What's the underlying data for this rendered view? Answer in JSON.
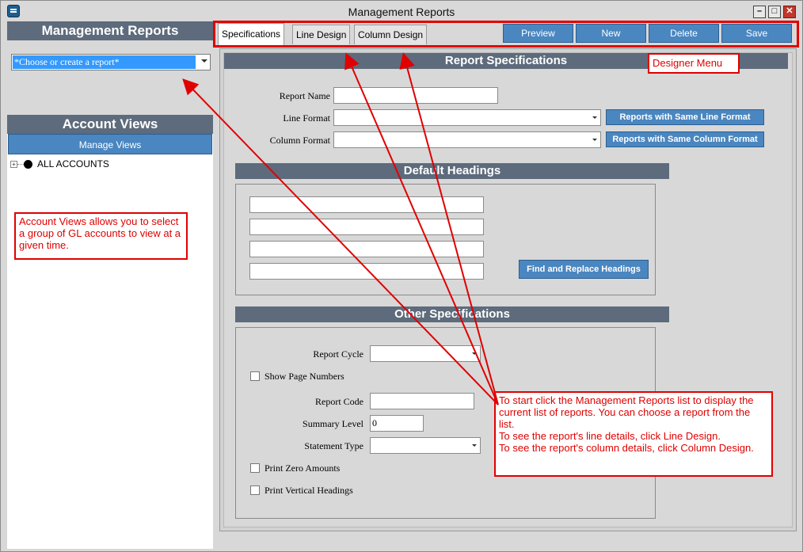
{
  "window": {
    "title": "Management Reports"
  },
  "left": {
    "management_reports_header": "Management Reports",
    "report_select_value": "*Choose or create a report*",
    "account_views_header": "Account Views",
    "manage_views_label": "Manage Views",
    "tree_root_label": "ALL ACCOUNTS"
  },
  "tabs": [
    {
      "label": "Specifications",
      "active": true
    },
    {
      "label": "Line Design",
      "active": false
    },
    {
      "label": "Column Design",
      "active": false
    }
  ],
  "toolbar": {
    "preview": "Preview",
    "new": "New",
    "delete": "Delete",
    "save": "Save"
  },
  "specs": {
    "section_title": "Report Specifications",
    "report_name_label": "Report Name",
    "line_format_label": "Line Format",
    "column_format_label": "Column Format",
    "same_line_btn": "Reports with Same Line Format",
    "same_column_btn": "Reports with Same Column Format"
  },
  "default_headings": {
    "title": "Default Headings",
    "find_replace_btn": "Find and Replace Headings"
  },
  "other_specs": {
    "title": "Other Specifications",
    "report_cycle_label": "Report Cycle",
    "show_page_numbers_label": "Show Page Numbers",
    "report_code_label": "Report Code",
    "summary_level_label": "Summary Level",
    "summary_level_value": "0",
    "statement_type_label": "Statement Type",
    "print_zero_label": "Print Zero Amounts",
    "print_vertical_label": "Print Vertical Headings"
  },
  "callouts": {
    "designer_menu": "Designer Menu",
    "account_views": "Account Views allows you to select a group of GL accounts to view at a given time.",
    "start_line1": "To start click the Management Reports list to display the current list of reports.  You can choose a report from the list.",
    "start_line2": "To see the report's line details, click Line Design.",
    "start_line3": "To see the report's column details, click Column Design."
  },
  "colors": {
    "accent_blue": "#4a86c0",
    "header_slate": "#5d6b7c",
    "callout_red": "#e00000"
  }
}
